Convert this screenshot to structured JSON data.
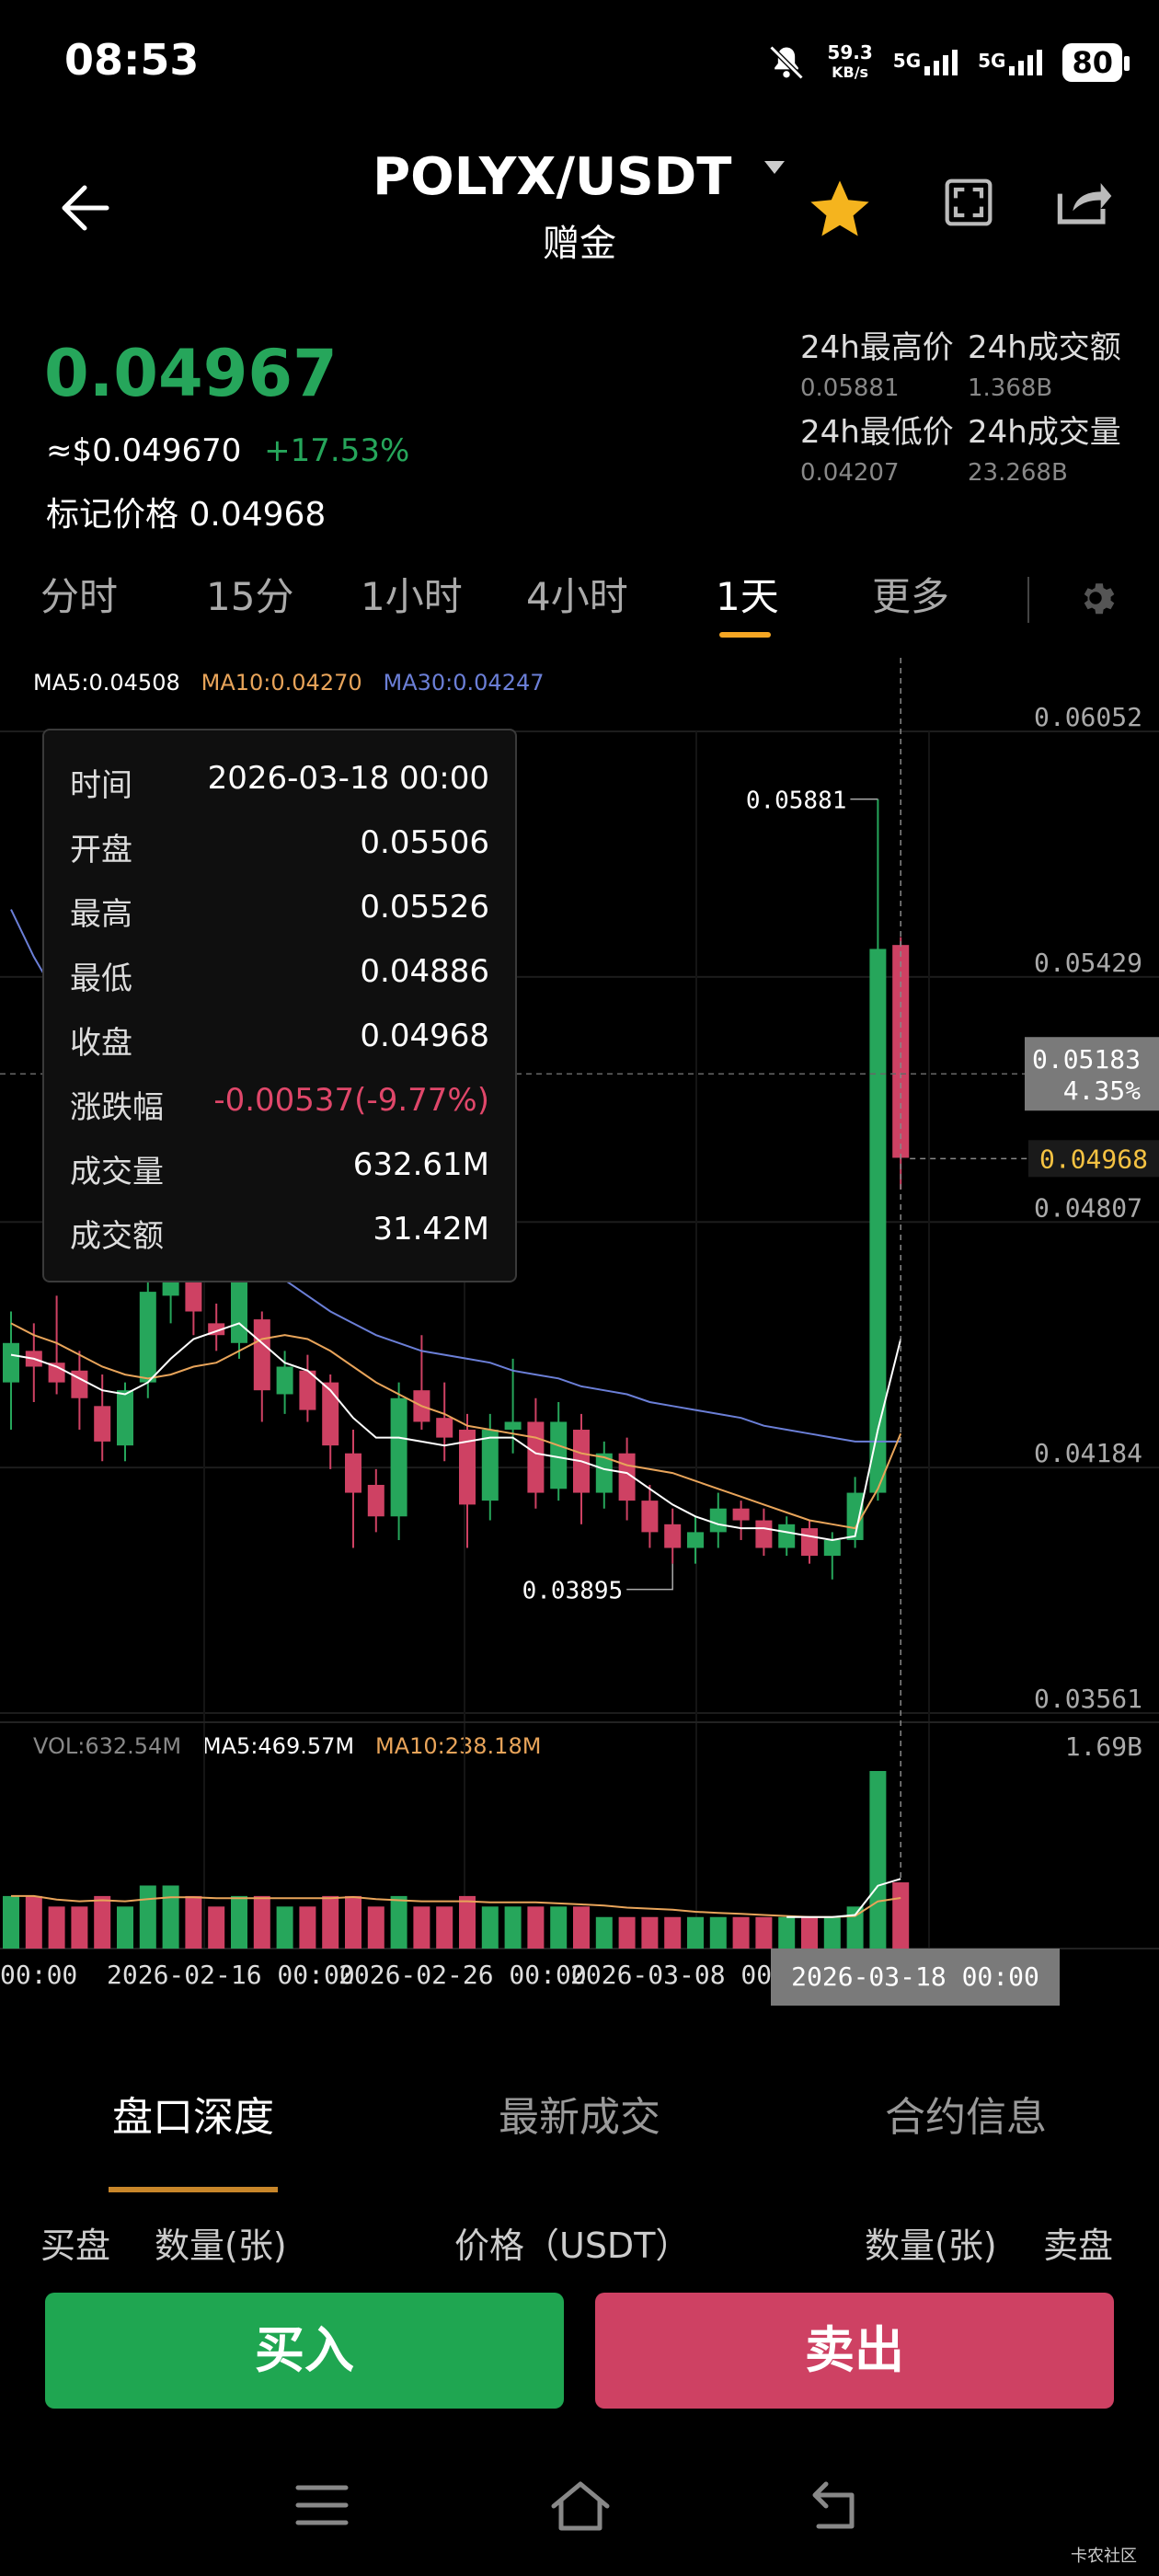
{
  "status_bar": {
    "time": "08:53",
    "net_speed_value": "59.3",
    "net_speed_unit": "KB/s",
    "sim1": "5G",
    "sim2": "5G",
    "battery": "80"
  },
  "header": {
    "pair": "POLYX/USDT",
    "subtitle": "赠金"
  },
  "ticker": {
    "last_price": "0.04967",
    "usd_price": "≈$0.049670",
    "change_pct": "+17.53%",
    "mark_price": "标记价格 0.04968",
    "high_label": "24h最高价",
    "high_value": "0.05881",
    "low_label": "24h最低价",
    "low_value": "0.04207",
    "turnover_label": "24h成交额",
    "turnover_value": "1.368B",
    "volume_label": "24h成交量",
    "volume_value": "23.268B"
  },
  "interval_tabs": [
    "分时",
    "15分",
    "1小时",
    "4小时",
    "1天",
    "更多"
  ],
  "active_interval": "1天",
  "indicators": {
    "ma5": "MA5:0.04508",
    "ma10": "MA10:0.04270",
    "ma30": "MA30:0.04247",
    "vol": "VOL:632.54M",
    "vol_ma5": "MA5:469.57M",
    "vol_ma10": "MA10:238.18M",
    "vol_max": "1.69B"
  },
  "colors": {
    "up": "#26a65b",
    "down": "#ce4163",
    "ma5": "#ffffff",
    "ma10": "#e8a45a",
    "ma30": "#6b7fd7",
    "tab_underline": "#f5a623",
    "last_price_tag": "#f5c242"
  },
  "tooltip": {
    "rows": [
      {
        "k": "时间",
        "v": "2026-03-18 00:00"
      },
      {
        "k": "开盘",
        "v": "0.05506"
      },
      {
        "k": "最高",
        "v": "0.05526"
      },
      {
        "k": "最低",
        "v": "0.04886"
      },
      {
        "k": "收盘",
        "v": "0.04968"
      },
      {
        "k": "涨跌幅",
        "v": "-0.00537(-9.77%)"
      },
      {
        "k": "成交量",
        "v": "632.61M"
      },
      {
        "k": "成交额",
        "v": "31.42M"
      }
    ]
  },
  "chart_data": {
    "type": "candlestick",
    "y_ticks": [
      "0.06052",
      "0.05429",
      "0.04807",
      "0.04184",
      "0.03561"
    ],
    "ylim": [
      0.03561,
      0.06052
    ],
    "annotations": {
      "high_label": "0.05881",
      "low_label": "0.03895",
      "crosshair_price": "0.05183",
      "crosshair_pct": "4.35%",
      "last_price_tag": "0.04968"
    },
    "x_labels": [
      "00:00",
      "2026-02-16  00:00",
      "2026-02-26  00:00",
      "2026-03-08  00",
      "2026-03-18  00:00"
    ],
    "candles": [
      {
        "o": 0.044,
        "h": 0.0458,
        "l": 0.0428,
        "c": 0.045
      },
      {
        "o": 0.0448,
        "h": 0.0455,
        "l": 0.0435,
        "c": 0.0444
      },
      {
        "o": 0.0445,
        "h": 0.0462,
        "l": 0.0437,
        "c": 0.044
      },
      {
        "o": 0.0443,
        "h": 0.0448,
        "l": 0.0428,
        "c": 0.0436
      },
      {
        "o": 0.0434,
        "h": 0.0442,
        "l": 0.042,
        "c": 0.0425
      },
      {
        "o": 0.0424,
        "h": 0.044,
        "l": 0.042,
        "c": 0.0438
      },
      {
        "o": 0.044,
        "h": 0.047,
        "l": 0.0436,
        "c": 0.0463
      },
      {
        "o": 0.0462,
        "h": 0.049,
        "l": 0.0455,
        "c": 0.0475
      },
      {
        "o": 0.0474,
        "h": 0.049,
        "l": 0.0452,
        "c": 0.0458
      },
      {
        "o": 0.0455,
        "h": 0.046,
        "l": 0.0448,
        "c": 0.0452
      },
      {
        "o": 0.045,
        "h": 0.0472,
        "l": 0.0446,
        "c": 0.0468
      },
      {
        "o": 0.0456,
        "h": 0.0458,
        "l": 0.043,
        "c": 0.0438
      },
      {
        "o": 0.0437,
        "h": 0.0448,
        "l": 0.0432,
        "c": 0.0444
      },
      {
        "o": 0.0443,
        "h": 0.0447,
        "l": 0.043,
        "c": 0.0433
      },
      {
        "o": 0.044,
        "h": 0.0442,
        "l": 0.0418,
        "c": 0.0424
      },
      {
        "o": 0.0422,
        "h": 0.0428,
        "l": 0.0398,
        "c": 0.0412
      },
      {
        "o": 0.0414,
        "h": 0.0418,
        "l": 0.0402,
        "c": 0.0406
      },
      {
        "o": 0.0406,
        "h": 0.044,
        "l": 0.04,
        "c": 0.0436
      },
      {
        "o": 0.0438,
        "h": 0.0452,
        "l": 0.0428,
        "c": 0.043
      },
      {
        "o": 0.0431,
        "h": 0.044,
        "l": 0.042,
        "c": 0.0426
      },
      {
        "o": 0.0428,
        "h": 0.0432,
        "l": 0.0398,
        "c": 0.0409
      },
      {
        "o": 0.041,
        "h": 0.0432,
        "l": 0.0405,
        "c": 0.0428
      },
      {
        "o": 0.0428,
        "h": 0.0446,
        "l": 0.0422,
        "c": 0.043
      },
      {
        "o": 0.043,
        "h": 0.0436,
        "l": 0.0408,
        "c": 0.0412
      },
      {
        "o": 0.0413,
        "h": 0.0435,
        "l": 0.041,
        "c": 0.043
      },
      {
        "o": 0.0428,
        "h": 0.0432,
        "l": 0.0404,
        "c": 0.0412
      },
      {
        "o": 0.0412,
        "h": 0.0425,
        "l": 0.0408,
        "c": 0.0422
      },
      {
        "o": 0.0422,
        "h": 0.0426,
        "l": 0.0405,
        "c": 0.041
      },
      {
        "o": 0.041,
        "h": 0.0414,
        "l": 0.0398,
        "c": 0.0402
      },
      {
        "o": 0.0404,
        "h": 0.0408,
        "l": 0.0394,
        "c": 0.0398
      },
      {
        "o": 0.0398,
        "h": 0.0406,
        "l": 0.0394,
        "c": 0.0402
      },
      {
        "o": 0.0402,
        "h": 0.0412,
        "l": 0.0398,
        "c": 0.0408
      },
      {
        "o": 0.0408,
        "h": 0.041,
        "l": 0.04,
        "c": 0.0405
      },
      {
        "o": 0.0405,
        "h": 0.0408,
        "l": 0.0396,
        "c": 0.0398
      },
      {
        "o": 0.0398,
        "h": 0.0406,
        "l": 0.0396,
        "c": 0.0404
      },
      {
        "o": 0.0403,
        "h": 0.0405,
        "l": 0.0394,
        "c": 0.0396
      },
      {
        "o": 0.0396,
        "h": 0.0402,
        "l": 0.039,
        "c": 0.04
      },
      {
        "o": 0.04,
        "h": 0.0416,
        "l": 0.0398,
        "c": 0.0412
      },
      {
        "o": 0.0412,
        "h": 0.0588,
        "l": 0.041,
        "c": 0.055
      },
      {
        "o": 0.0551,
        "h": 0.0553,
        "l": 0.0489,
        "c": 0.0497
      }
    ],
    "ma5_line": [
      0.0447,
      0.0446,
      0.0444,
      0.0441,
      0.0438,
      0.0437,
      0.044,
      0.0446,
      0.0451,
      0.0453,
      0.0455,
      0.045,
      0.0445,
      0.0443,
      0.0438,
      0.0431,
      0.0426,
      0.0426,
      0.0425,
      0.0424,
      0.0425,
      0.0426,
      0.0426,
      0.0422,
      0.0421,
      0.042,
      0.0418,
      0.0417,
      0.0413,
      0.0409,
      0.0406,
      0.0404,
      0.0403,
      0.0403,
      0.0402,
      0.0401,
      0.04,
      0.0401,
      0.0428,
      0.0451
    ],
    "ma10_line": [
      0.0455,
      0.0452,
      0.045,
      0.0447,
      0.0444,
      0.0442,
      0.0441,
      0.0442,
      0.0444,
      0.0445,
      0.0448,
      0.0451,
      0.0452,
      0.0451,
      0.0448,
      0.0444,
      0.044,
      0.0437,
      0.0434,
      0.0432,
      0.0429,
      0.0428,
      0.0427,
      0.0426,
      0.0424,
      0.0422,
      0.0421,
      0.0419,
      0.0418,
      0.0417,
      0.0415,
      0.0413,
      0.0411,
      0.0409,
      0.0407,
      0.0405,
      0.0404,
      0.0403,
      0.0413,
      0.0427
    ],
    "ma30_line": [
      0.056,
      0.0548,
      0.0538,
      0.0528,
      0.0518,
      0.0508,
      0.0498,
      0.049,
      0.0484,
      0.0478,
      0.0473,
      0.0469,
      0.0466,
      0.0462,
      0.0458,
      0.0455,
      0.0452,
      0.045,
      0.0448,
      0.0447,
      0.0446,
      0.0445,
      0.0443,
      0.0442,
      0.0441,
      0.0439,
      0.0438,
      0.0437,
      0.0435,
      0.0434,
      0.0433,
      0.0432,
      0.0431,
      0.0429,
      0.0428,
      0.0427,
      0.0426,
      0.0425,
      0.0425,
      0.0425
    ],
    "volume": [
      0.5,
      0.5,
      0.4,
      0.4,
      0.5,
      0.4,
      0.6,
      0.6,
      0.5,
      0.4,
      0.5,
      0.5,
      0.4,
      0.4,
      0.5,
      0.5,
      0.4,
      0.5,
      0.4,
      0.4,
      0.5,
      0.4,
      0.4,
      0.4,
      0.4,
      0.4,
      0.3,
      0.3,
      0.3,
      0.3,
      0.3,
      0.3,
      0.3,
      0.3,
      0.3,
      0.3,
      0.3,
      0.4,
      1.69,
      0.63
    ]
  },
  "bottom_tabs": [
    "盘口深度",
    "最新成交",
    "合约信息"
  ],
  "active_bottom_tab": "盘口深度",
  "book_columns": {
    "bid": "买盘",
    "qty_left": "数量(张)",
    "price": "价格（USDT）",
    "qty_right": "数量(张)",
    "ask": "卖盘"
  },
  "actions": {
    "buy": "买入",
    "sell": "卖出"
  },
  "watermark": "卡农社区"
}
